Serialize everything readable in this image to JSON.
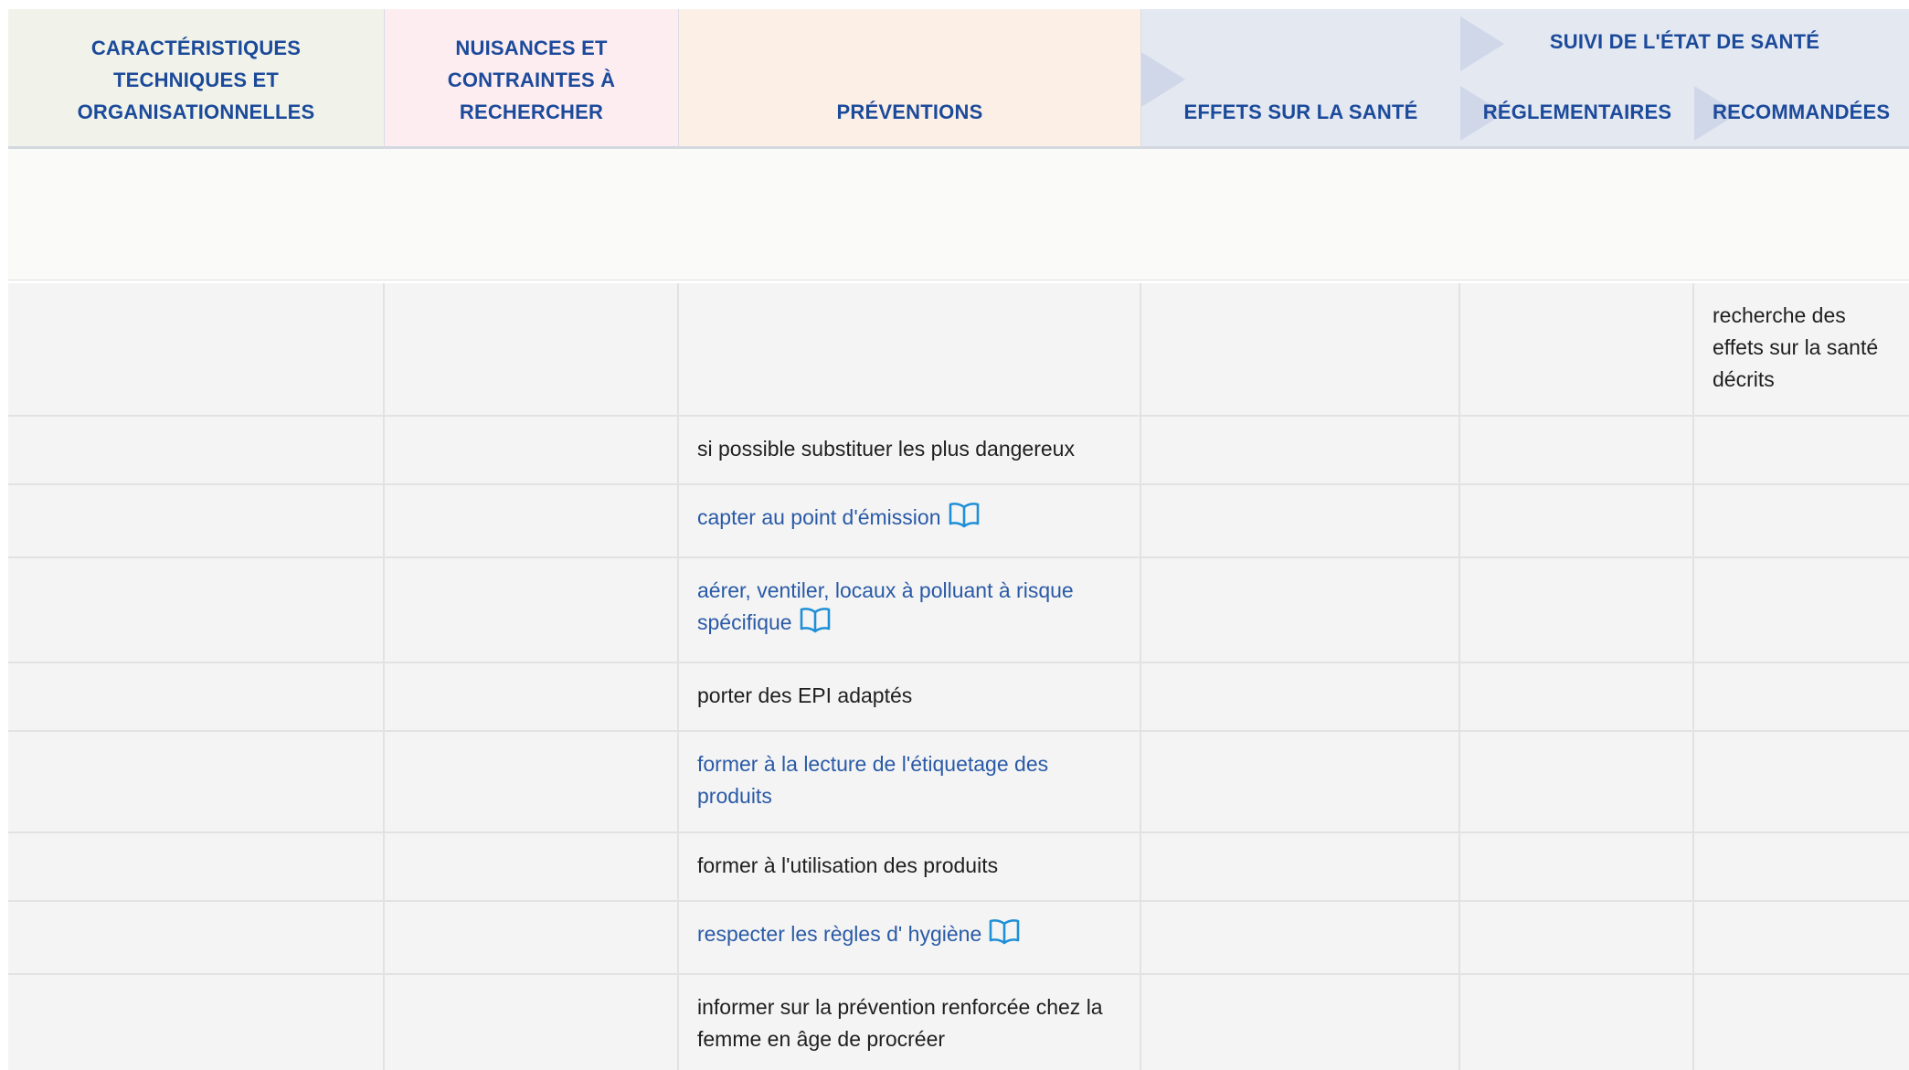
{
  "header": {
    "technical": [
      "CARACTÉRISTIQUES",
      "TECHNIQUES ET",
      "ORGANISATIONNELLES"
    ],
    "nuisances": [
      "NUISANCES ET",
      "CONTRAINTES À",
      "RECHERCHER"
    ],
    "preventions": "PRÉVENTIONS",
    "health_effects": "EFFETS SUR LA SANTÉ",
    "health_monitoring": "SUIVI DE L'ÉTAT DE SANTÉ",
    "regulatory": "RÉGLEMENTAIRES",
    "recommended": "RECOMMANDÉES"
  },
  "rows": [
    {
      "recommended": "recherche des effets sur la santé décrits"
    },
    {
      "prevention": "si possible substituer les plus dangereux",
      "link": false,
      "icon": ""
    },
    {
      "prevention": "capter au point d'émission",
      "link": true,
      "icon": "book-icon"
    },
    {
      "prevention": "aérer, ventiler, locaux à polluant à risque spécifique",
      "link": true,
      "icon": "book-icon"
    },
    {
      "prevention": "porter des EPI adaptés",
      "link": false,
      "icon": ""
    },
    {
      "prevention": "former à la lecture de l'étiquetage des produits",
      "link": true,
      "icon": ""
    },
    {
      "prevention": "former à l'utilisation des produits",
      "link": false,
      "icon": ""
    },
    {
      "prevention": "respecter les règles d' hygiène",
      "link": true,
      "icon": "book-icon"
    },
    {
      "prevention": "informer sur la prévention renforcée chez la femme en âge de procréer",
      "link": false,
      "icon": ""
    }
  ],
  "colors": {
    "header_text": "#1c4a9a",
    "link_text": "#2a5aa6",
    "book_icon": "#1e8fd6"
  }
}
